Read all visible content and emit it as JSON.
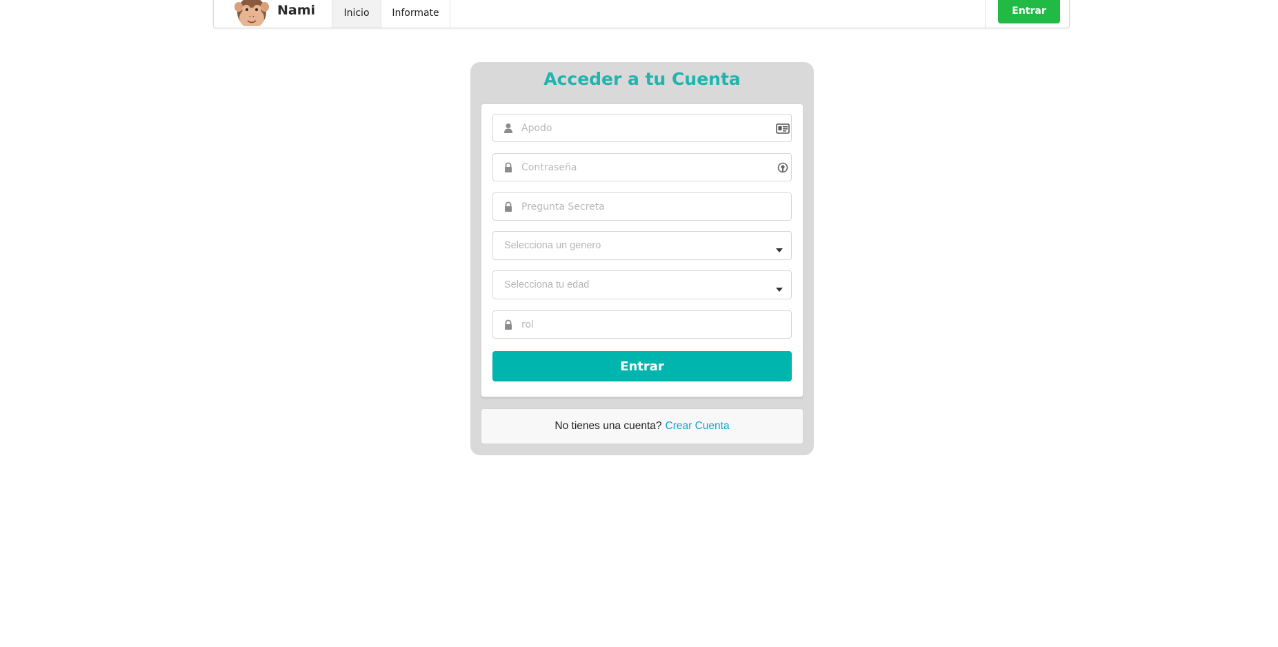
{
  "navbar": {
    "brand": "Nami",
    "items": [
      {
        "label": "Inicio",
        "active": true
      },
      {
        "label": "Informate",
        "active": false
      }
    ],
    "login_button": "Entrar"
  },
  "login": {
    "title": "Acceder a tu Cuenta",
    "fields": {
      "nickname": {
        "placeholder": "Apodo",
        "icon": "user-icon",
        "trailing_icon": "id-card-icon"
      },
      "password": {
        "placeholder": "Contraseña",
        "icon": "lock-icon",
        "trailing_icon": "password-manager-icon"
      },
      "secret_question": {
        "placeholder": "Pregunta Secreta",
        "icon": "lock-icon"
      },
      "gender": {
        "placeholder": "Selecciona un genero",
        "icon": "caret-down-icon"
      },
      "age": {
        "placeholder": "Selecciona tu edad",
        "icon": "caret-down-icon"
      },
      "role": {
        "placeholder": "rol",
        "icon": "lock-icon"
      }
    },
    "submit_label": "Entrar",
    "signup": {
      "text": "No tienes una cuenta?",
      "link": "Crear Cuenta"
    }
  },
  "colors": {
    "accent": "#00b5ad",
    "title": "#1fb4ad",
    "nav_button": "#21ba45",
    "link": "#0fa4d6",
    "card_bg": "#d9d9d9"
  }
}
